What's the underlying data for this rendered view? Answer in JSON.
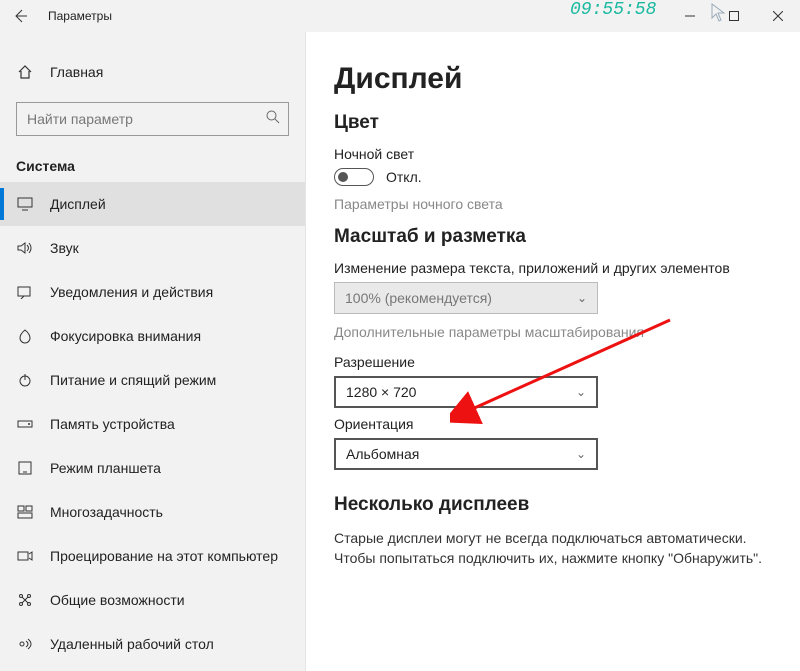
{
  "titlebar": {
    "title": "Параметры"
  },
  "clock": "09:55:58",
  "sidebar": {
    "home": "Главная",
    "search_placeholder": "Найти параметр",
    "group": "Система",
    "items": [
      {
        "label": "Дисплей"
      },
      {
        "label": "Звук"
      },
      {
        "label": "Уведомления и действия"
      },
      {
        "label": "Фокусировка внимания"
      },
      {
        "label": "Питание и спящий режим"
      },
      {
        "label": "Память устройства"
      },
      {
        "label": "Режим планшета"
      },
      {
        "label": "Многозадачность"
      },
      {
        "label": "Проецирование на этот компьютер"
      },
      {
        "label": "Общие возможности"
      },
      {
        "label": "Удаленный рабочий стол"
      }
    ]
  },
  "content": {
    "h1": "Дисплей",
    "color_h": "Цвет",
    "night_label": "Ночной свет",
    "night_state": "Откл.",
    "night_link": "Параметры ночного света",
    "scale_h": "Масштаб и разметка",
    "scale_label": "Изменение размера текста, приложений и других элементов",
    "scale_value": "100% (рекомендуется)",
    "scale_link": "Дополнительные параметры масштабирования",
    "res_label": "Разрешение",
    "res_value": "1280 × 720",
    "orient_label": "Ориентация",
    "orient_value": "Альбомная",
    "multi_h": "Несколько дисплеев",
    "multi_text": "Старые дисплеи могут не всегда подключаться автоматически. Чтобы попытаться подключить их, нажмите кнопку \"Обнаружить\"."
  }
}
